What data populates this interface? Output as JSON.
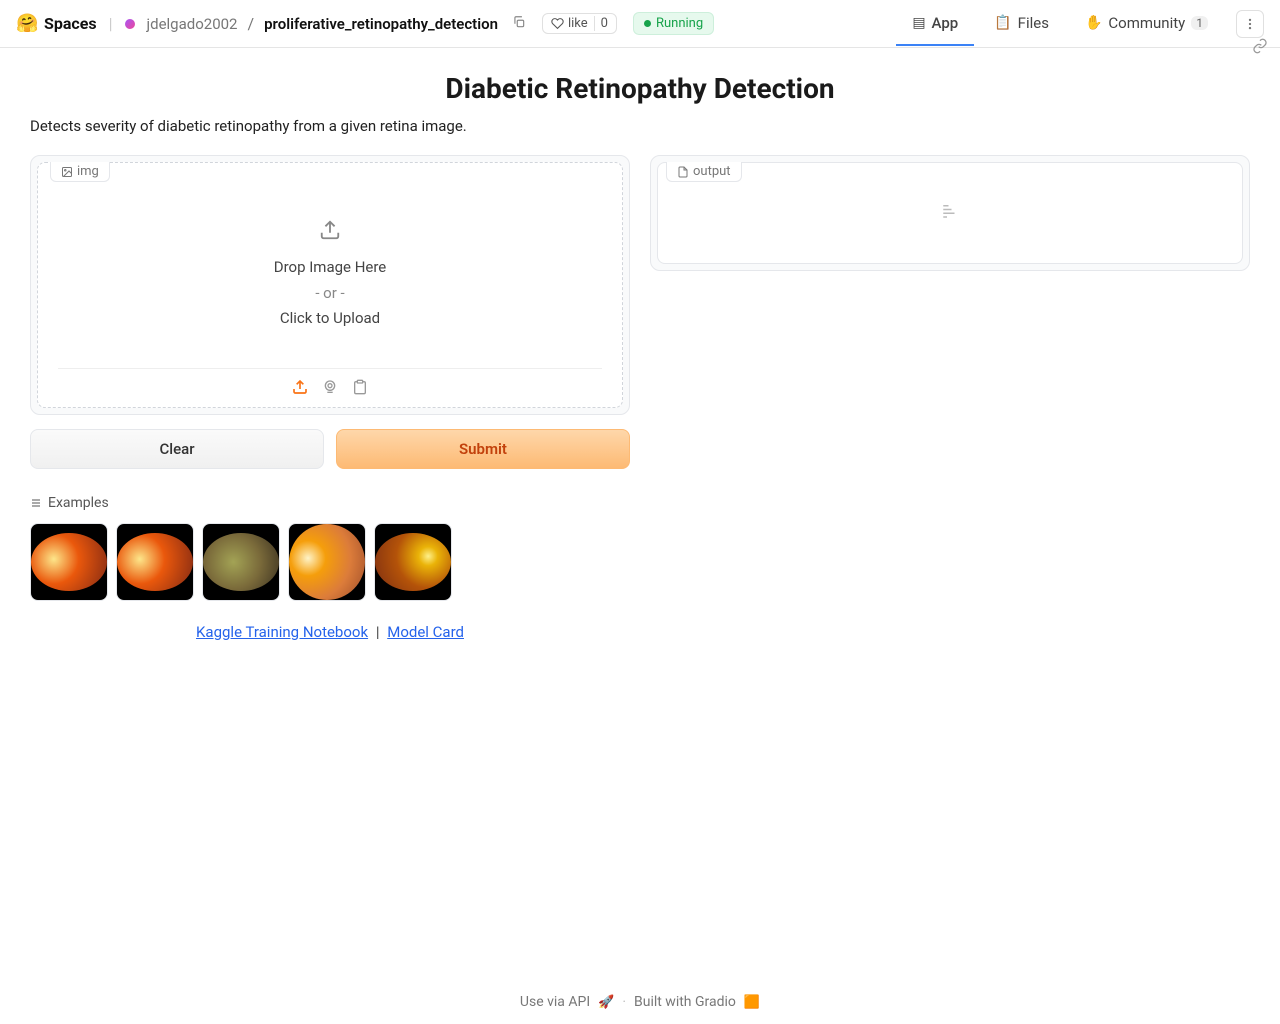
{
  "header": {
    "spaces_label": "Spaces",
    "owner": "jdelgado2002",
    "repo": "proliferative_retinopathy_detection",
    "like_label": "like",
    "like_count": "0",
    "status": "Running",
    "nav": {
      "app": "App",
      "files": "Files",
      "community": "Community",
      "community_count": "1"
    }
  },
  "app": {
    "title": "Diabetic Retinopathy Detection",
    "description": "Detects severity of diabetic retinopathy from a given retina image.",
    "input_label": "img",
    "output_label": "output",
    "drop_line1": "Drop Image Here",
    "drop_or": "- or -",
    "drop_line2": "Click to Upload",
    "clear_btn": "Clear",
    "submit_btn": "Submit",
    "examples_label": "Examples"
  },
  "links": {
    "kaggle": "Kaggle Training Notebook",
    "model_card": "Model Card"
  },
  "footer": {
    "api": "Use via API",
    "built": "Built with Gradio"
  }
}
